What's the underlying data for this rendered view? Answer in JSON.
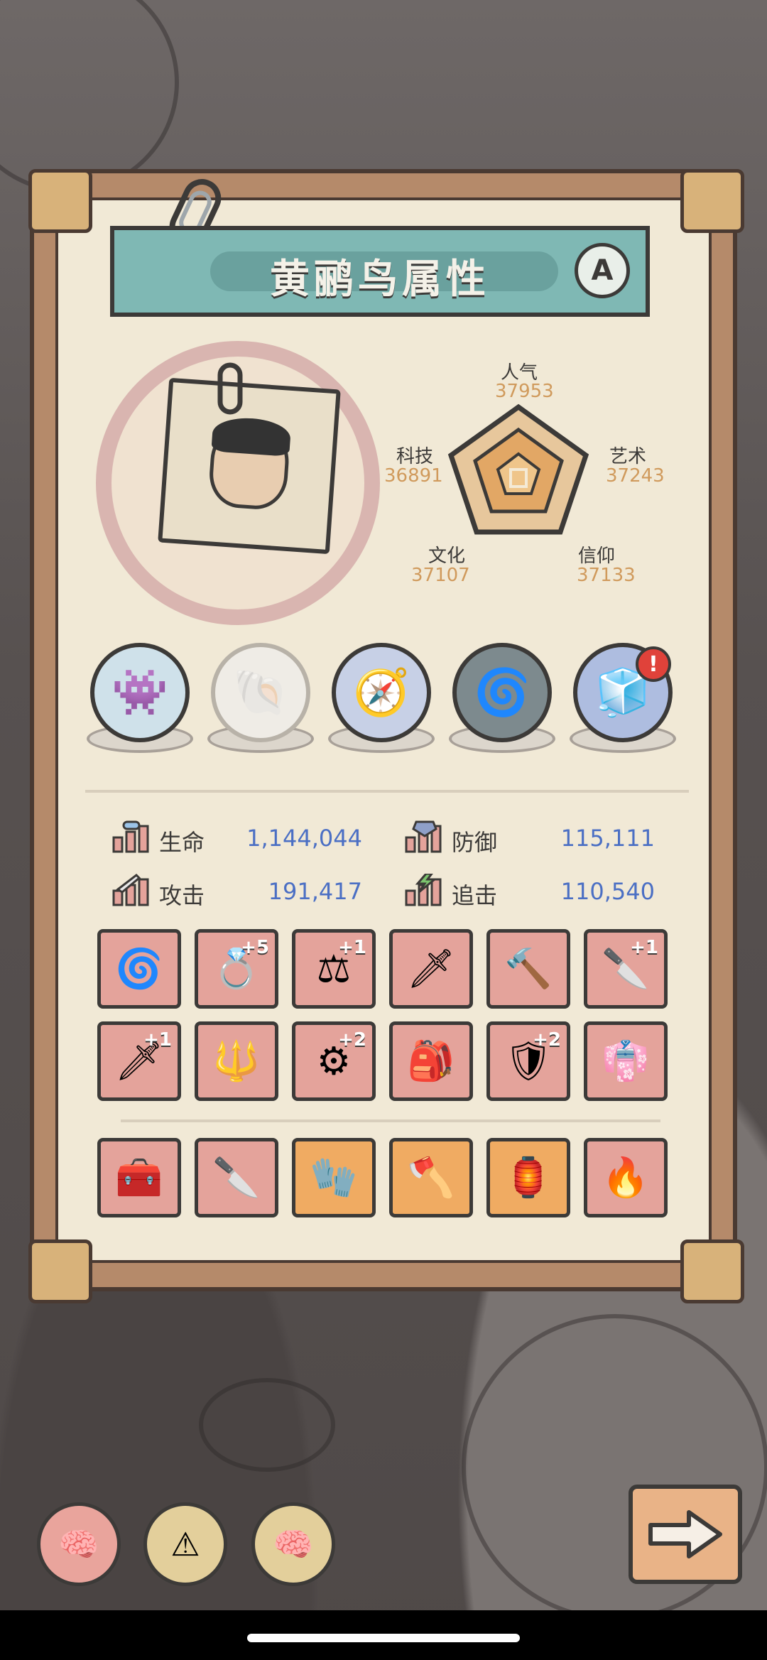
{
  "title": "黄鹂鸟属性",
  "grade": "A",
  "radar": {
    "popularity": {
      "label": "人气",
      "value": "37953"
    },
    "tech": {
      "label": "科技",
      "value": "36891"
    },
    "art": {
      "label": "艺术",
      "value": "37243"
    },
    "culture": {
      "label": "文化",
      "value": "37107"
    },
    "faith": {
      "label": "信仰",
      "value": "37133"
    }
  },
  "orbs": [
    {
      "icon": "monster-orb-icon"
    },
    {
      "icon": "empty-shell-orb-icon"
    },
    {
      "icon": "compass-orb-icon"
    },
    {
      "icon": "jade-ring-orb-icon"
    },
    {
      "icon": "gem-box-orb-icon"
    }
  ],
  "alert_badge": "!",
  "attributes": {
    "hp": {
      "label": "生命",
      "value": "1,144,044"
    },
    "defense": {
      "label": "防御",
      "value": "115,111"
    },
    "attack": {
      "label": "攻击",
      "value": "191,417"
    },
    "pursuit": {
      "label": "追击",
      "value": "110,540"
    }
  },
  "equipment_rows": [
    [
      {
        "icon": "gold-coil-icon",
        "plus": ""
      },
      {
        "icon": "bracelet-icon",
        "plus": "+5"
      },
      {
        "icon": "scales-icon",
        "plus": "+1"
      },
      {
        "icon": "sword-icon",
        "plus": ""
      },
      {
        "icon": "mace-icon",
        "plus": ""
      },
      {
        "icon": "dagger-icon",
        "plus": "+1"
      }
    ],
    [
      {
        "icon": "short-sword-icon",
        "plus": "+1"
      },
      {
        "icon": "trident-icon",
        "plus": ""
      },
      {
        "icon": "gear-relic-icon",
        "plus": "+2"
      },
      {
        "icon": "backpack-icon",
        "plus": ""
      },
      {
        "icon": "armor-icon",
        "plus": "+2"
      },
      {
        "icon": "cape-icon",
        "plus": ""
      }
    ],
    [
      {
        "icon": "chest-icon",
        "plus": "",
        "tone": "red"
      },
      {
        "icon": "blade-icon",
        "plus": "",
        "tone": "red"
      },
      {
        "icon": "claw-glove-icon",
        "plus": "",
        "tone": "orange"
      },
      {
        "icon": "axe-icon",
        "plus": "",
        "tone": "orange"
      },
      {
        "icon": "lantern-icon",
        "plus": "",
        "tone": "orange"
      },
      {
        "icon": "fire-axe-icon",
        "plus": "",
        "tone": "red"
      }
    ]
  ],
  "bottom_buttons": [
    {
      "icon": "brain-tv-icon"
    },
    {
      "icon": "warning-tv-icon"
    },
    {
      "icon": "pink-brain-icon"
    }
  ],
  "colors": {
    "title_bar": "#7fb8b4",
    "attr_value": "#4b6fc4",
    "radar_value": "#d09a5c",
    "slot_red": "#e4a39b",
    "slot_orange": "#f0ab62"
  }
}
